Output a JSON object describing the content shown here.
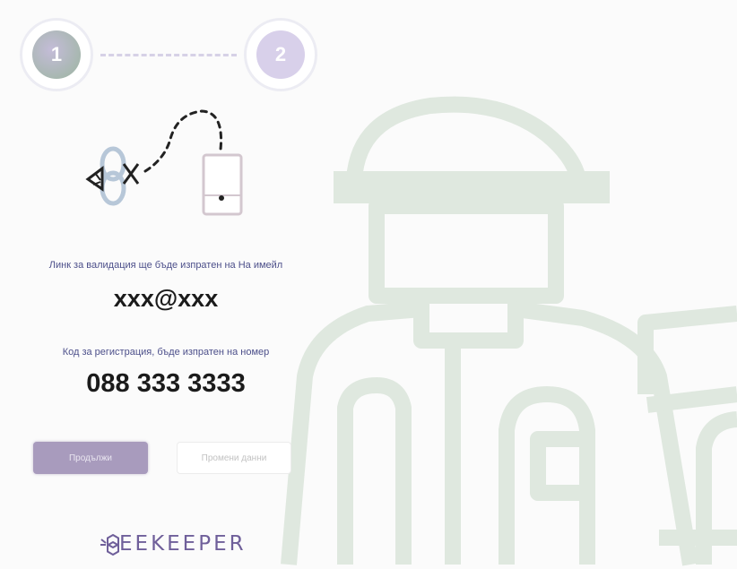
{
  "steps": [
    {
      "number": "1",
      "state": "active"
    },
    {
      "number": "2",
      "state": "inactive"
    }
  ],
  "illustration": {
    "icon": "bee-flying-to-phone-illustration"
  },
  "email_section": {
    "message": "Линк за валидация ще бъде изпратен на На имейл",
    "email": "xxx@xxx"
  },
  "phone_section": {
    "message": "Код за регистрация, бъде изпратен на номер",
    "phone": "088 333 3333"
  },
  "buttons": {
    "primary_label": "Продължи",
    "secondary_label": "Промени данни"
  },
  "logo": {
    "text": "EEKEEPER"
  },
  "colors": {
    "accent": "#a89bbd",
    "text_primary": "#1b1b1b",
    "text_secondary": "#4c4f8a",
    "background": "#fbfbfb"
  }
}
